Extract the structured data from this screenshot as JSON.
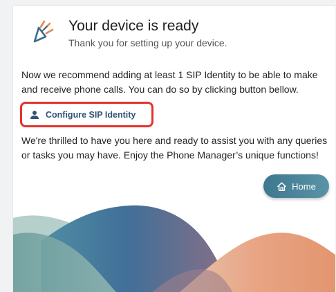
{
  "header": {
    "title": "Your device is ready",
    "subtitle": "Thank you for setting up your device."
  },
  "body": {
    "recommendation": "Now we recommend adding at least 1 SIP Identity to be able to make and receive phone calls. You can do so by clicking button bellow.",
    "thanks": "We're thrilled to have you here and ready to assist you with any queries or tasks you may have. Enjoy the Phone Manager’s unique functions!"
  },
  "actions": {
    "configure_label": "Configure SIP Identity",
    "home_label": "Home"
  },
  "icons": {
    "logo": "sparkle-logo-icon",
    "configure": "person-icon",
    "home": "home-icon"
  },
  "colors": {
    "highlight": "#e4322b",
    "accent_text": "#2f5577",
    "home_button": "#4a86a0",
    "logo_orange": "#e8854e",
    "logo_blue": "#3b6d8a"
  }
}
